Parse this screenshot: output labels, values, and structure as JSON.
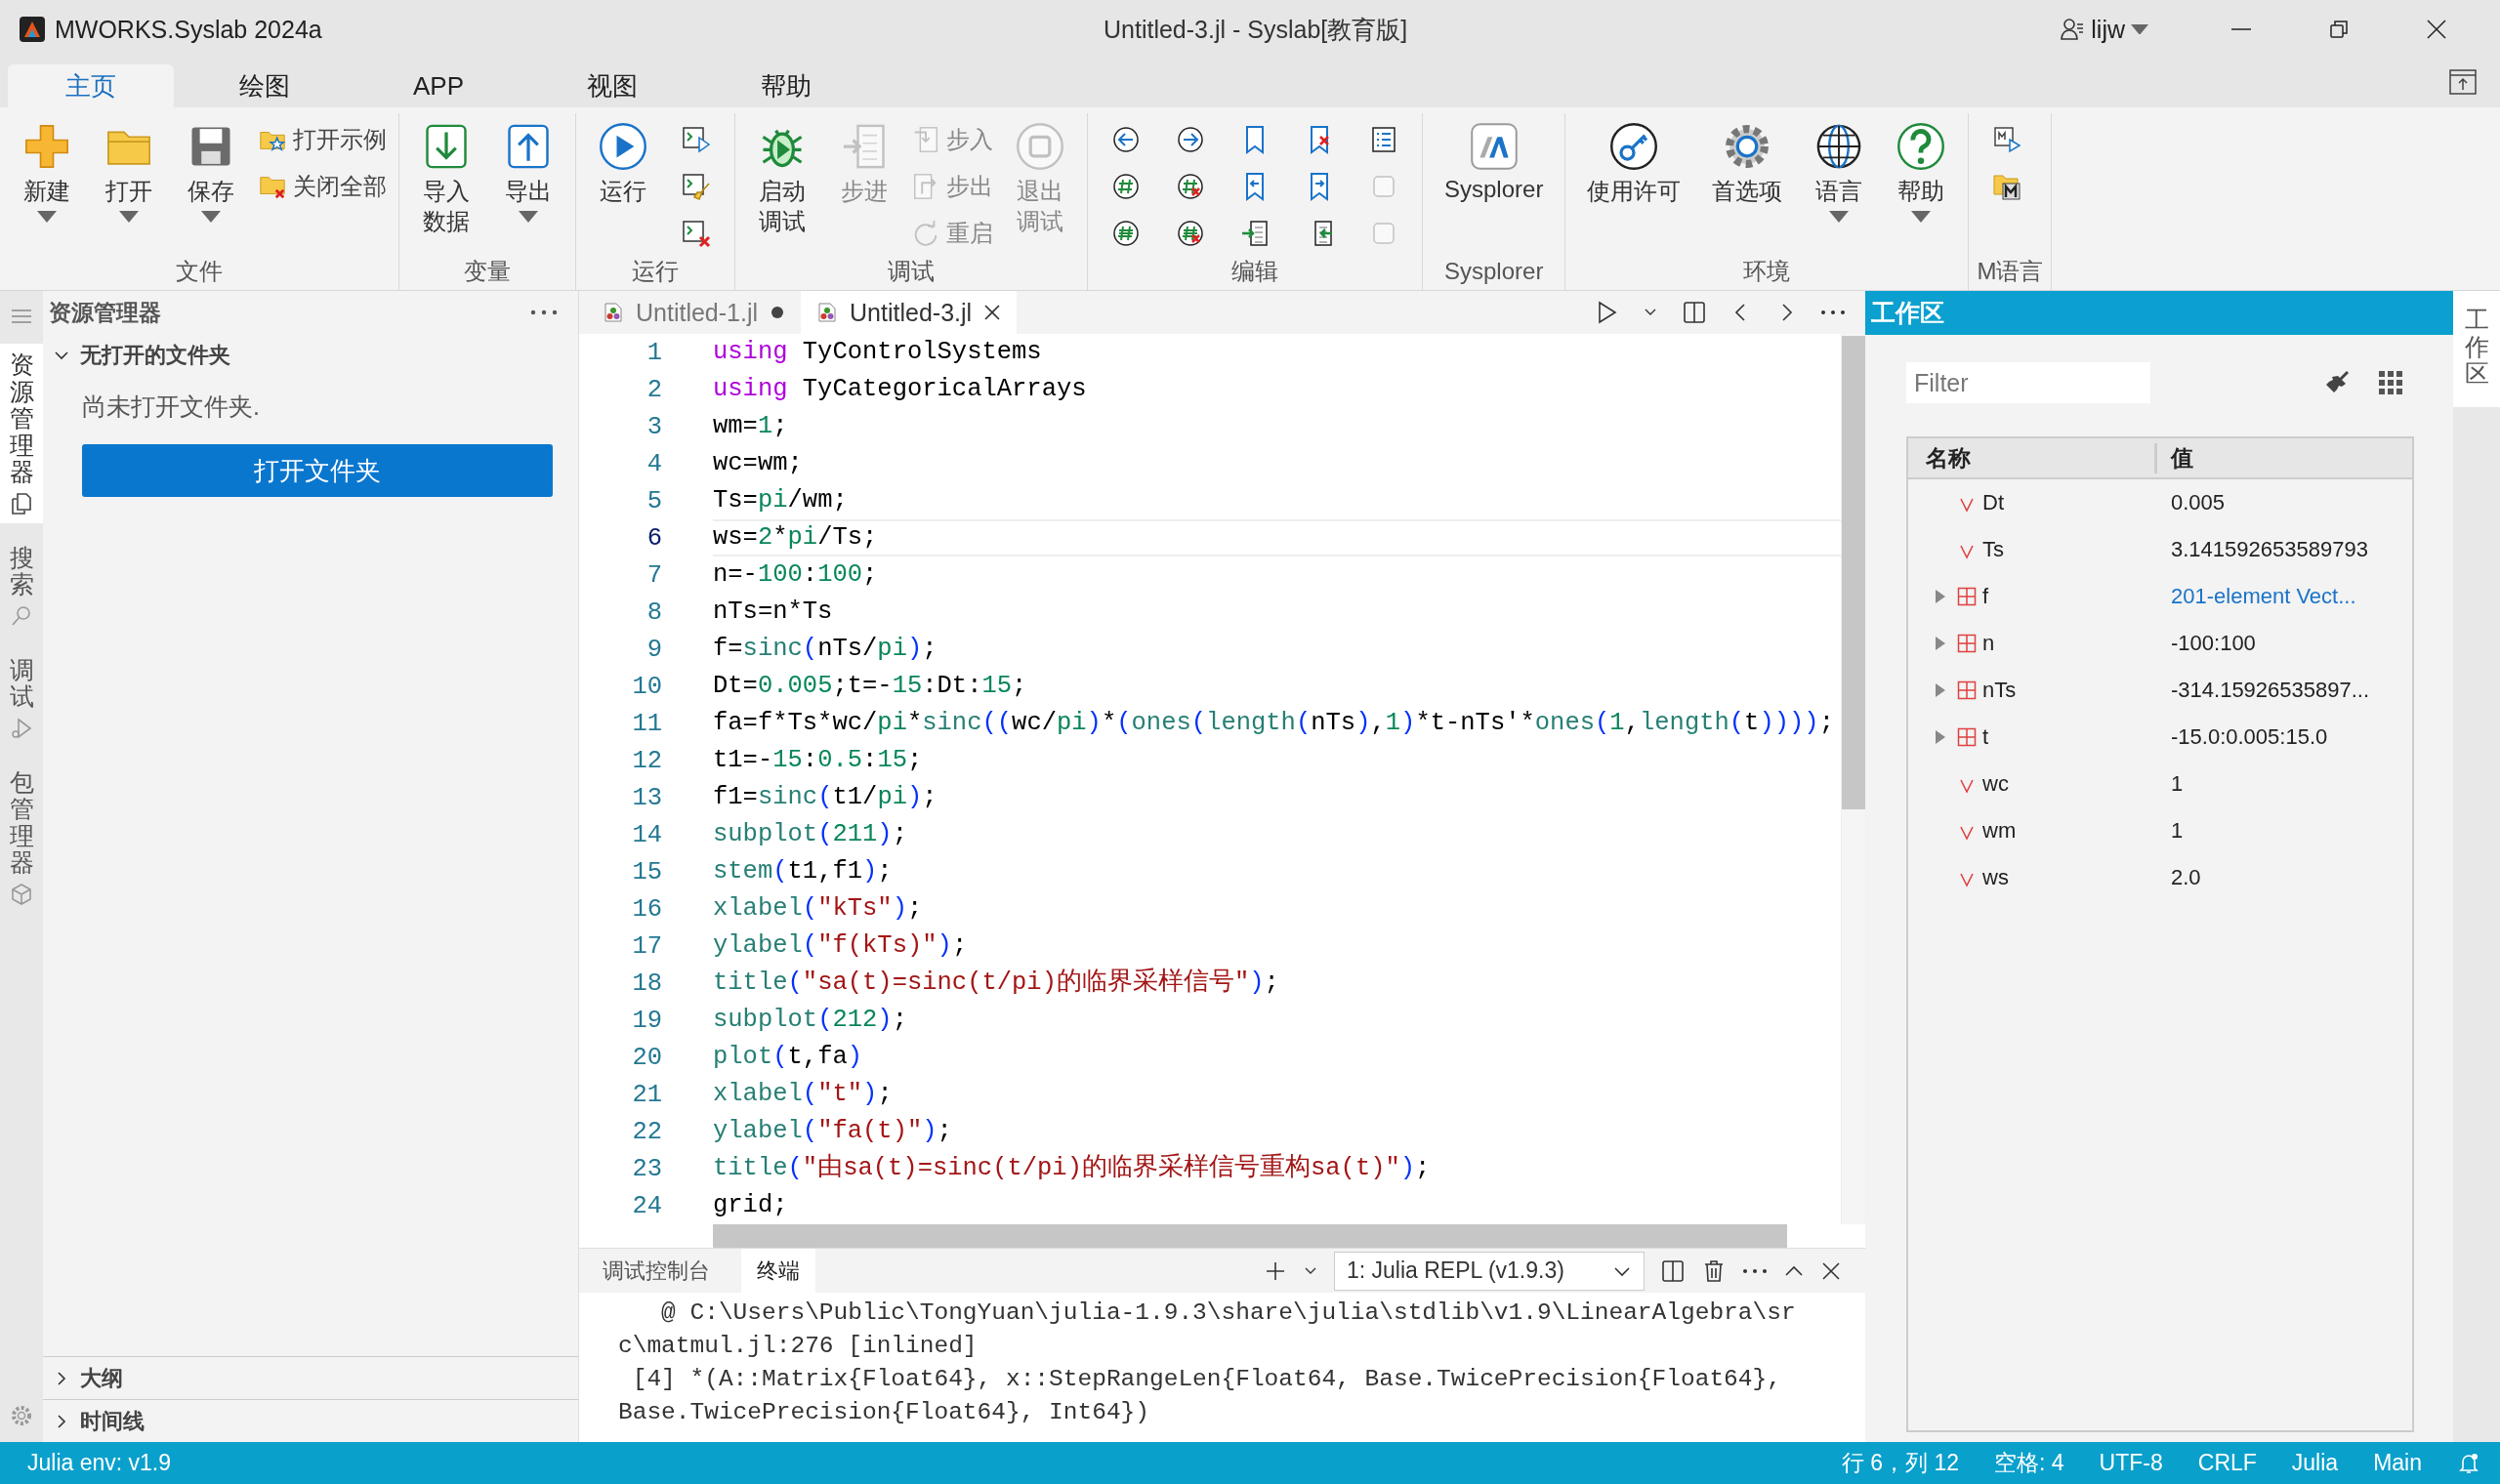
{
  "title_bar": {
    "app_name": "MWORKS.Syslab 2024a",
    "title": "Untitled-3.jl - Syslab[教育版]",
    "user": "lijw"
  },
  "ribbon": {
    "tabs": [
      {
        "label": "主页",
        "selected": true
      },
      {
        "label": "绘图",
        "selected": false
      },
      {
        "label": "APP",
        "selected": false
      },
      {
        "label": "视图",
        "selected": false
      },
      {
        "label": "帮助",
        "selected": false
      }
    ],
    "groups": [
      {
        "label": "文件",
        "items": [
          {
            "kind": "large",
            "label": "新建",
            "dropdown": true,
            "disabled": false
          },
          {
            "kind": "large",
            "label": "打开",
            "dropdown": true,
            "disabled": false
          },
          {
            "kind": "large",
            "label": "保存",
            "dropdown": true,
            "disabled": false
          },
          {
            "kind": "small",
            "label": "打开示例",
            "disabled": false
          },
          {
            "kind": "small",
            "label": "关闭全部",
            "disabled": false
          }
        ]
      },
      {
        "label": "变量",
        "items": [
          {
            "kind": "large-stacked",
            "label": "导入数据",
            "dropdown": false,
            "disabled": false
          },
          {
            "kind": "large",
            "label": "导出",
            "dropdown": true,
            "disabled": false
          }
        ]
      },
      {
        "label": "运行",
        "items": [
          {
            "kind": "large",
            "label": "运行",
            "dropdown": false,
            "disabled": false
          },
          {
            "kind": "icon",
            "disabled": false
          },
          {
            "kind": "icon",
            "disabled": false
          },
          {
            "kind": "icon",
            "disabled": false
          }
        ]
      },
      {
        "label": "调试",
        "items": [
          {
            "kind": "large-stacked",
            "label": "启动调试",
            "dropdown": false,
            "disabled": false
          },
          {
            "kind": "large",
            "label": "步进",
            "dropdown": false,
            "disabled": true
          },
          {
            "kind": "small",
            "label": "步入",
            "disabled": true
          },
          {
            "kind": "small",
            "label": "步出",
            "disabled": true
          },
          {
            "kind": "small",
            "label": "重启",
            "disabled": true
          },
          {
            "kind": "large-stacked",
            "label": "退出调试",
            "dropdown": false,
            "disabled": true
          }
        ]
      },
      {
        "label": "编辑",
        "items": [
          {
            "kind": "icon",
            "disabled": false
          },
          {
            "kind": "icon",
            "disabled": false
          },
          {
            "kind": "icon",
            "disabled": false
          },
          {
            "kind": "icon",
            "disabled": false
          },
          {
            "kind": "icon",
            "disabled": false
          },
          {
            "kind": "icon",
            "disabled": false
          },
          {
            "kind": "icon",
            "disabled": false
          },
          {
            "kind": "icon",
            "disabled": false
          },
          {
            "kind": "icon",
            "disabled": false
          },
          {
            "kind": "icon",
            "disabled": false
          },
          {
            "kind": "icon",
            "disabled": false
          },
          {
            "kind": "icon",
            "disabled": false
          },
          {
            "kind": "icon",
            "disabled": false
          },
          {
            "kind": "icon",
            "disabled": true
          },
          {
            "kind": "icon",
            "disabled": true
          }
        ]
      },
      {
        "label": "Sysplorer",
        "items": [
          {
            "kind": "large",
            "label": "Sysplorer",
            "dropdown": false,
            "disabled": false
          }
        ]
      },
      {
        "label": "环境",
        "items": [
          {
            "kind": "large",
            "label": "使用许可",
            "dropdown": false,
            "disabled": false
          },
          {
            "kind": "large",
            "label": "首选项",
            "dropdown": false,
            "disabled": false
          },
          {
            "kind": "large",
            "label": "语言",
            "dropdown": true,
            "disabled": false
          },
          {
            "kind": "large",
            "label": "帮助",
            "dropdown": true,
            "disabled": false
          }
        ]
      },
      {
        "label": "M语言",
        "items": [
          {
            "kind": "icon",
            "disabled": false
          },
          {
            "kind": "icon",
            "disabled": false
          }
        ]
      }
    ]
  },
  "activity_bar": {
    "items": [
      {
        "label": "资源管理器",
        "selected": true
      },
      {
        "label": "搜索",
        "selected": false
      },
      {
        "label": "调试",
        "selected": false
      },
      {
        "label": "包管理器",
        "selected": false
      }
    ]
  },
  "explorer": {
    "title": "资源管理器",
    "folder_section": {
      "label": "无打开的文件夹",
      "expanded": true,
      "message": "尚未打开文件夹.",
      "button": "打开文件夹"
    },
    "sections": [
      {
        "label": "大纲",
        "expanded": false
      },
      {
        "label": "时间线",
        "expanded": false
      }
    ]
  },
  "editor": {
    "tabs": [
      {
        "label": "Untitled-1.jl",
        "selected": false,
        "modified": true
      },
      {
        "label": "Untitled-3.jl",
        "selected": true,
        "modified": false
      }
    ],
    "lines": [
      {
        "number": "1",
        "current": false,
        "tokens": [
          {
            "kind": "kw",
            "text": "using"
          },
          {
            "kind": "plain",
            "text": " TyControlSystems"
          }
        ]
      },
      {
        "number": "2",
        "current": false,
        "tokens": [
          {
            "kind": "kw",
            "text": "using"
          },
          {
            "kind": "plain",
            "text": " TyCategoricalArrays"
          }
        ]
      },
      {
        "number": "3",
        "current": false,
        "tokens": [
          {
            "kind": "plain",
            "text": "wm="
          },
          {
            "kind": "num",
            "text": "1"
          },
          {
            "kind": "plain",
            "text": ";"
          }
        ]
      },
      {
        "number": "4",
        "current": false,
        "tokens": [
          {
            "kind": "plain",
            "text": "wc=wm;"
          }
        ]
      },
      {
        "number": "5",
        "current": false,
        "tokens": [
          {
            "kind": "plain",
            "text": "Ts="
          },
          {
            "kind": "num",
            "text": "pi"
          },
          {
            "kind": "plain",
            "text": "/wm;"
          }
        ]
      },
      {
        "number": "6",
        "current": true,
        "tokens": [
          {
            "kind": "plain",
            "text": "ws="
          },
          {
            "kind": "num",
            "text": "2"
          },
          {
            "kind": "plain",
            "text": "*"
          },
          {
            "kind": "num",
            "text": "pi"
          },
          {
            "kind": "plain",
            "text": "/Ts;"
          }
        ]
      },
      {
        "number": "7",
        "current": false,
        "tokens": [
          {
            "kind": "plain",
            "text": "n=-"
          },
          {
            "kind": "num",
            "text": "100"
          },
          {
            "kind": "plain",
            "text": ":"
          },
          {
            "kind": "num",
            "text": "100"
          },
          {
            "kind": "plain",
            "text": ";"
          }
        ]
      },
      {
        "number": "8",
        "current": false,
        "tokens": [
          {
            "kind": "plain",
            "text": "nTs=n*Ts"
          }
        ]
      },
      {
        "number": "9",
        "current": false,
        "tokens": [
          {
            "kind": "plain",
            "text": "f="
          },
          {
            "kind": "fn",
            "text": "sinc"
          },
          {
            "kind": "paren",
            "text": "("
          },
          {
            "kind": "plain",
            "text": "nTs/"
          },
          {
            "kind": "num",
            "text": "pi"
          },
          {
            "kind": "paren",
            "text": ")"
          },
          {
            "kind": "plain",
            "text": ";"
          }
        ]
      },
      {
        "number": "10",
        "current": false,
        "tokens": [
          {
            "kind": "plain",
            "text": "Dt="
          },
          {
            "kind": "num",
            "text": "0.005"
          },
          {
            "kind": "plain",
            "text": ";t=-"
          },
          {
            "kind": "num",
            "text": "15"
          },
          {
            "kind": "plain",
            "text": ":Dt:"
          },
          {
            "kind": "num",
            "text": "15"
          },
          {
            "kind": "plain",
            "text": ";"
          }
        ]
      },
      {
        "number": "11",
        "current": false,
        "tokens": [
          {
            "kind": "plain",
            "text": "fa=f*Ts*wc/"
          },
          {
            "kind": "num",
            "text": "pi"
          },
          {
            "kind": "plain",
            "text": "*"
          },
          {
            "kind": "fn",
            "text": "sinc"
          },
          {
            "kind": "paren",
            "text": "(("
          },
          {
            "kind": "plain",
            "text": "wc/"
          },
          {
            "kind": "num",
            "text": "pi"
          },
          {
            "kind": "paren",
            "text": ")"
          },
          {
            "kind": "plain",
            "text": "*"
          },
          {
            "kind": "paren",
            "text": "("
          },
          {
            "kind": "fn",
            "text": "ones"
          },
          {
            "kind": "paren",
            "text": "("
          },
          {
            "kind": "fn",
            "text": "length"
          },
          {
            "kind": "paren",
            "text": "("
          },
          {
            "kind": "plain",
            "text": "nTs"
          },
          {
            "kind": "paren",
            "text": ")"
          },
          {
            "kind": "plain",
            "text": ","
          },
          {
            "kind": "num",
            "text": "1"
          },
          {
            "kind": "paren",
            "text": ")"
          },
          {
            "kind": "plain",
            "text": "*t-nTs'*"
          },
          {
            "kind": "fn",
            "text": "ones"
          },
          {
            "kind": "paren",
            "text": "("
          },
          {
            "kind": "num",
            "text": "1"
          },
          {
            "kind": "plain",
            "text": ","
          },
          {
            "kind": "fn",
            "text": "length"
          },
          {
            "kind": "paren",
            "text": "("
          },
          {
            "kind": "plain",
            "text": "t"
          },
          {
            "kind": "paren",
            "text": "))))"
          },
          {
            "kind": "plain",
            "text": ";"
          }
        ]
      },
      {
        "number": "12",
        "current": false,
        "tokens": [
          {
            "kind": "plain",
            "text": "t1=-"
          },
          {
            "kind": "num",
            "text": "15"
          },
          {
            "kind": "plain",
            "text": ":"
          },
          {
            "kind": "num",
            "text": "0.5"
          },
          {
            "kind": "plain",
            "text": ":"
          },
          {
            "kind": "num",
            "text": "15"
          },
          {
            "kind": "plain",
            "text": ";"
          }
        ]
      },
      {
        "number": "13",
        "current": false,
        "tokens": [
          {
            "kind": "plain",
            "text": "f1="
          },
          {
            "kind": "fn",
            "text": "sinc"
          },
          {
            "kind": "paren",
            "text": "("
          },
          {
            "kind": "plain",
            "text": "t1/"
          },
          {
            "kind": "num",
            "text": "pi"
          },
          {
            "kind": "paren",
            "text": ")"
          },
          {
            "kind": "plain",
            "text": ";"
          }
        ]
      },
      {
        "number": "14",
        "current": false,
        "tokens": [
          {
            "kind": "fn",
            "text": "subplot"
          },
          {
            "kind": "paren",
            "text": "("
          },
          {
            "kind": "num",
            "text": "211"
          },
          {
            "kind": "paren",
            "text": ")"
          },
          {
            "kind": "plain",
            "text": ";"
          }
        ]
      },
      {
        "number": "15",
        "current": false,
        "tokens": [
          {
            "kind": "fn",
            "text": "stem"
          },
          {
            "kind": "paren",
            "text": "("
          },
          {
            "kind": "plain",
            "text": "t1,f1"
          },
          {
            "kind": "paren",
            "text": ")"
          },
          {
            "kind": "plain",
            "text": ";"
          }
        ]
      },
      {
        "number": "16",
        "current": false,
        "tokens": [
          {
            "kind": "fn",
            "text": "xlabel"
          },
          {
            "kind": "paren",
            "text": "("
          },
          {
            "kind": "str",
            "text": "\"kTs\""
          },
          {
            "kind": "paren",
            "text": ")"
          },
          {
            "kind": "plain",
            "text": ";"
          }
        ]
      },
      {
        "number": "17",
        "current": false,
        "tokens": [
          {
            "kind": "fn",
            "text": "ylabel"
          },
          {
            "kind": "paren",
            "text": "("
          },
          {
            "kind": "str",
            "text": "\"f(kTs)\""
          },
          {
            "kind": "paren",
            "text": ")"
          },
          {
            "kind": "plain",
            "text": ";"
          }
        ]
      },
      {
        "number": "18",
        "current": false,
        "tokens": [
          {
            "kind": "fn",
            "text": "title"
          },
          {
            "kind": "paren",
            "text": "("
          },
          {
            "kind": "str",
            "text": "\"sa(t)=sinc(t/pi)的临界采样信号\""
          },
          {
            "kind": "paren",
            "text": ")"
          },
          {
            "kind": "plain",
            "text": ";"
          }
        ]
      },
      {
        "number": "19",
        "current": false,
        "tokens": [
          {
            "kind": "fn",
            "text": "subplot"
          },
          {
            "kind": "paren",
            "text": "("
          },
          {
            "kind": "num",
            "text": "212"
          },
          {
            "kind": "paren",
            "text": ")"
          },
          {
            "kind": "plain",
            "text": ";"
          }
        ]
      },
      {
        "number": "20",
        "current": false,
        "tokens": [
          {
            "kind": "fn",
            "text": "plot"
          },
          {
            "kind": "paren",
            "text": "("
          },
          {
            "kind": "plain",
            "text": "t,fa"
          },
          {
            "kind": "paren",
            "text": ")"
          }
        ]
      },
      {
        "number": "21",
        "current": false,
        "tokens": [
          {
            "kind": "fn",
            "text": "xlabel"
          },
          {
            "kind": "paren",
            "text": "("
          },
          {
            "kind": "str",
            "text": "\"t\""
          },
          {
            "kind": "paren",
            "text": ")"
          },
          {
            "kind": "plain",
            "text": ";"
          }
        ]
      },
      {
        "number": "22",
        "current": false,
        "tokens": [
          {
            "kind": "fn",
            "text": "ylabel"
          },
          {
            "kind": "paren",
            "text": "("
          },
          {
            "kind": "str",
            "text": "\"fa(t)\""
          },
          {
            "kind": "paren",
            "text": ")"
          },
          {
            "kind": "plain",
            "text": ";"
          }
        ]
      },
      {
        "number": "23",
        "current": false,
        "tokens": [
          {
            "kind": "fn",
            "text": "title"
          },
          {
            "kind": "paren",
            "text": "("
          },
          {
            "kind": "str",
            "text": "\"由sa(t)=sinc(t/pi)的临界采样信号重构sa(t)\""
          },
          {
            "kind": "paren",
            "text": ")"
          },
          {
            "kind": "plain",
            "text": ";"
          }
        ]
      },
      {
        "number": "24",
        "current": false,
        "tokens": [
          {
            "kind": "plain",
            "text": "grid;"
          }
        ]
      }
    ]
  },
  "panel": {
    "tabs": [
      {
        "label": "调试控制台",
        "selected": false
      },
      {
        "label": "终端",
        "selected": true
      }
    ],
    "terminal_select": "1: Julia REPL (v1.9.3)",
    "output": [
      "   @ C:\\Users\\Public\\TongYuan\\julia-1.9.3\\share\\julia\\stdlib\\v1.9\\LinearAlgebra\\sr",
      "c\\matmul.jl:276 [inlined]",
      " [4] *(A::Matrix{Float64}, x::StepRangeLen{Float64, Base.TwicePrecision{Float64},",
      "Base.TwicePrecision{Float64}, Int64})"
    ]
  },
  "workspace": {
    "title": "工作区",
    "filter": {
      "placeholder": "Filter"
    },
    "columns": [
      "名称",
      "值"
    ],
    "rows": [
      {
        "kind": "scalar",
        "name": "Dt",
        "value": "0.005",
        "value_link": false
      },
      {
        "kind": "scalar",
        "name": "Ts",
        "value": "3.141592653589793",
        "value_link": false
      },
      {
        "kind": "array",
        "name": "f",
        "value": "201-element Vect...",
        "value_link": true,
        "expanded": false
      },
      {
        "kind": "array",
        "name": "n",
        "value": "-100:100",
        "value_link": false,
        "expanded": false
      },
      {
        "kind": "array",
        "name": "nTs",
        "value": "-314.15926535897...",
        "value_link": false,
        "expanded": false
      },
      {
        "kind": "array",
        "name": "t",
        "value": "-15.0:0.005:15.0",
        "value_link": false,
        "expanded": false
      },
      {
        "kind": "scalar",
        "name": "wc",
        "value": "1",
        "value_link": false
      },
      {
        "kind": "scalar",
        "name": "wm",
        "value": "1",
        "value_link": false
      },
      {
        "kind": "scalar",
        "name": "ws",
        "value": "2.0",
        "value_link": false
      }
    ]
  },
  "side_strip": {
    "label": "工作区",
    "selected": true
  },
  "status_bar": {
    "env": "Julia env: v1.9",
    "items": [
      "行 6，列 12",
      "空格: 4",
      "UTF-8",
      "CRLF",
      "Julia",
      "Main"
    ]
  }
}
